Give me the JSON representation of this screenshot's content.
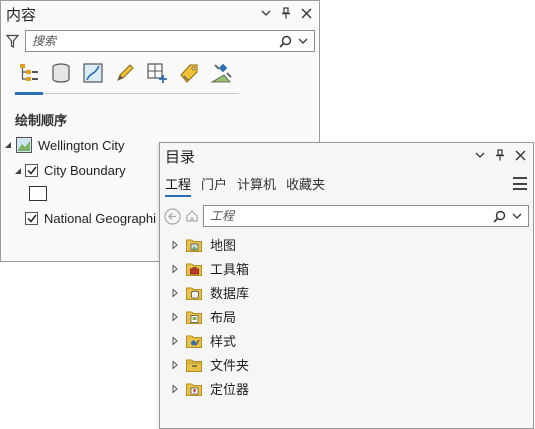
{
  "contents_panel": {
    "title": "内容",
    "search_placeholder": "搜索",
    "section_title": "绘制顺序",
    "map_name": "Wellington City",
    "layers": [
      {
        "label": "City Boundary",
        "checked": true
      },
      {
        "label": "National Geographi",
        "checked": true
      }
    ],
    "toolbar_icons": [
      "list-by-drawing-order-icon",
      "list-by-data-source-icon",
      "list-by-selection-icon",
      "list-by-editing-icon",
      "list-by-snapping-icon",
      "list-by-labeling-icon",
      "list-by-perspective-imagery-icon"
    ]
  },
  "catalog_panel": {
    "title": "目录",
    "tabs": [
      "工程",
      "门户",
      "计算机",
      "收藏夹"
    ],
    "active_tab": "工程",
    "search_placeholder": "工程",
    "items": [
      {
        "label": "地图",
        "icon": "maps-folder-icon"
      },
      {
        "label": "工具箱",
        "icon": "toolboxes-folder-icon"
      },
      {
        "label": "数据库",
        "icon": "databases-folder-icon"
      },
      {
        "label": "布局",
        "icon": "layouts-folder-icon"
      },
      {
        "label": "样式",
        "icon": "styles-folder-icon"
      },
      {
        "label": "文件夹",
        "icon": "folders-folder-icon"
      },
      {
        "label": "定位器",
        "icon": "locators-folder-icon"
      }
    ]
  },
  "colors": {
    "accent": "#2b6fb5",
    "folder": "#e8c14a",
    "folder_dark": "#c9a12d"
  }
}
